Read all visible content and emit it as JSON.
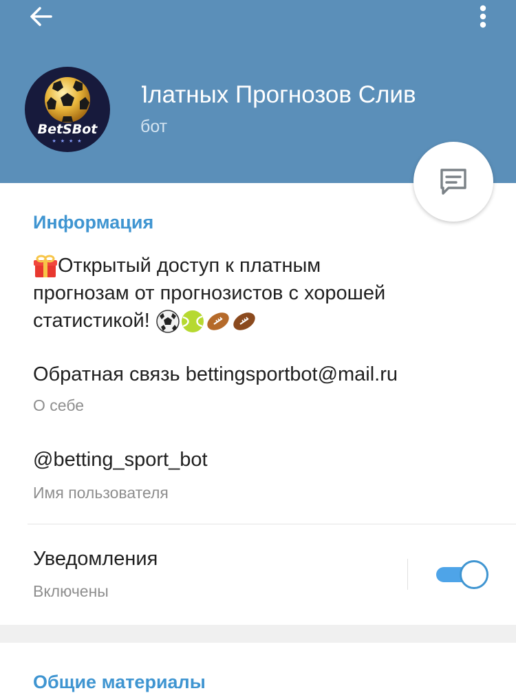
{
  "header": {
    "back_icon": "arrow-left-icon",
    "menu_icon": "more-vertical-icon",
    "avatar_text": "BetSBot",
    "title": "Платных Прогнозов   Слив",
    "subtitle": "бот",
    "background": "#5b8fb9",
    "fab_icon": "message-icon"
  },
  "info": {
    "heading": "Информация",
    "description_lines": [
      "Открытый доступ к платным",
      "прогнозам от прогнозистов с хорошей",
      "статистикой!"
    ],
    "description_emojis": [
      "gift-emoji",
      "soccer-ball-emoji",
      "tennis-ball-emoji",
      "football-emoji",
      "football-emoji"
    ],
    "about_value": "Обратная связь bettingsportbot@mail.ru",
    "about_caption": "О себе",
    "username_value": "@betting_sport_bot",
    "username_caption": "Имя пользователя",
    "notifications_label": "Уведомления",
    "notifications_status": "Включены",
    "notifications_enabled": true,
    "accent": "#3f95d1"
  },
  "shared": {
    "heading": "Общие материалы"
  }
}
